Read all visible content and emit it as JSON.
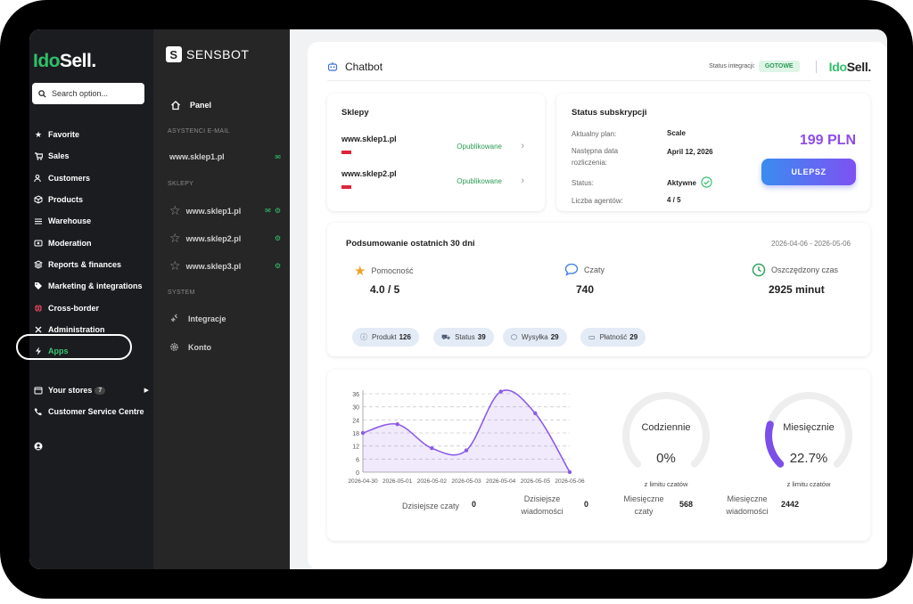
{
  "idosell": {
    "logo_a": "Ido",
    "logo_b": "Sell.",
    "search_placeholder": "Search option...",
    "nav": [
      {
        "label": "Favorite",
        "icon": "star-icon"
      },
      {
        "label": "Sales",
        "icon": "cart-icon"
      },
      {
        "label": "Customers",
        "icon": "users-icon"
      },
      {
        "label": "Products",
        "icon": "box-icon"
      },
      {
        "label": "Warehouse",
        "icon": "warehouse-icon"
      },
      {
        "label": "Moderation",
        "icon": "moderation-icon"
      },
      {
        "label": "Reports & finances",
        "icon": "layers-icon"
      },
      {
        "label": "Marketing & integrations",
        "icon": "tag-icon"
      },
      {
        "label": "Cross-border",
        "icon": "globe-icon"
      },
      {
        "label": "Administration",
        "icon": "tools-icon"
      },
      {
        "label": "Apps",
        "icon": "bolt-icon"
      }
    ],
    "stores_label": "Your stores",
    "stores_count": "7",
    "service_label": "Customer Service Centre"
  },
  "sensbot": {
    "logo": "SENSBOT",
    "panel_label": "Panel",
    "section_email": "ASYSTENCI E-MAIL",
    "email_store": "www.sklep1.pl",
    "section_shops": "SKLEPY",
    "shops": [
      "www.sklep1.pl",
      "www.sklep2.pl",
      "www.sklep3.pl"
    ],
    "section_system": "SYSTEM",
    "integracje": "Integracje",
    "konto": "Konto"
  },
  "topbar": {
    "title": "Chatbot",
    "status_label": "Status integracji:",
    "status_value": "GOTOWE",
    "logo_a": "Ido",
    "logo_b": "Sell."
  },
  "sklepy": {
    "title": "Sklepy",
    "rows": [
      {
        "url": "www.sklep1.pl",
        "status": "Opublikowane"
      },
      {
        "url": "www.sklep2.pl",
        "status": "Opublikowane"
      }
    ]
  },
  "subskrypcja": {
    "title": "Status subskrypcji",
    "plan_label": "Aktualny plan:",
    "plan_value": "Scale",
    "next_label": "Następna data rozliczenia:",
    "next_value": "April 12, 2026",
    "status_label": "Status:",
    "status_value": "Aktywne",
    "agents_label": "Liczba agentów:",
    "agents_value": "4 / 5",
    "price": "199 PLN",
    "upgrade": "ULEPSZ"
  },
  "summary": {
    "title": "Podsumowanie ostatnich 30 dni",
    "range": "2026-04-06 - 2026-05-06",
    "metrics": [
      {
        "label": "Pomocność",
        "value": "4.0 / 5"
      },
      {
        "label": "Czaty",
        "value": "740"
      },
      {
        "label": "Oszczędzony czas",
        "value": "2925 minut"
      }
    ],
    "chips": [
      {
        "label": "Produkt",
        "count": "126"
      },
      {
        "label": "Status",
        "count": "39"
      },
      {
        "label": "Wysyłka",
        "count": "29"
      },
      {
        "label": "Płatność",
        "count": "29"
      }
    ]
  },
  "chart_data": {
    "type": "area",
    "x": [
      "2026-04-30",
      "2026-05-01",
      "2026-05-02",
      "2026-05-03",
      "2026-05-04",
      "2026-05-05",
      "2026-05-06"
    ],
    "values": [
      18,
      22,
      11,
      10,
      37,
      27,
      0
    ],
    "yticks": [
      0,
      6,
      12,
      18,
      24,
      30,
      36
    ],
    "ylim": [
      0,
      36
    ],
    "grid": true,
    "color": "#8c5ce6"
  },
  "gauges": [
    {
      "label": "Codziennie",
      "pct": "0%",
      "fraction": 0.0,
      "sub": "z limitu czatów"
    },
    {
      "label": "Miesięcznie",
      "pct": "22.7%",
      "fraction": 0.227,
      "sub": "z limitu czatów"
    }
  ],
  "stats": [
    {
      "label_a": "Dzisiejsze czaty",
      "label_b": "",
      "value": "0"
    },
    {
      "label_a": "Dzisiejsze",
      "label_b": "wiadomości",
      "value": "0"
    },
    {
      "label_a": "Miesięczne",
      "label_b": "czaty",
      "value": "568"
    },
    {
      "label_a": "Miesięczne",
      "label_b": "wiadomości",
      "value": "2442"
    }
  ]
}
